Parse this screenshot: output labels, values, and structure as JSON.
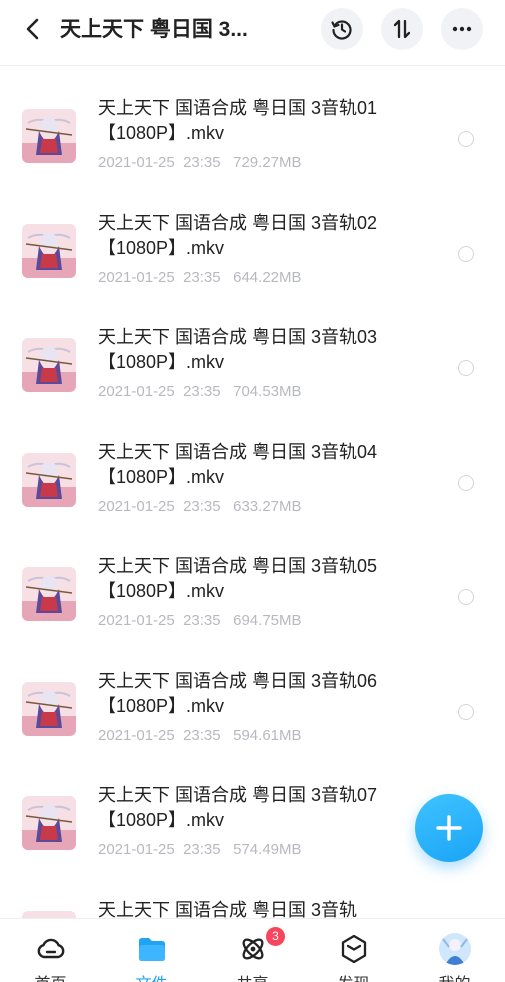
{
  "header": {
    "title": "天上天下 粤日国 3...",
    "back_icon": "chevron-left-icon",
    "history_icon": "history-icon",
    "sort_icon": "sort-icon",
    "more_icon": "more-icon"
  },
  "files": [
    {
      "name": "天上天下 国语合成 粤日国 3音轨01【1080P】.mkv",
      "date": "2021-01-25  23:35",
      "size": "729.27MB"
    },
    {
      "name": "天上天下 国语合成 粤日国 3音轨02【1080P】.mkv",
      "date": "2021-01-25  23:35",
      "size": "644.22MB"
    },
    {
      "name": "天上天下 国语合成 粤日国 3音轨03【1080P】.mkv",
      "date": "2021-01-25  23:35",
      "size": "704.53MB"
    },
    {
      "name": "天上天下 国语合成 粤日国 3音轨04【1080P】.mkv",
      "date": "2021-01-25  23:35",
      "size": "633.27MB"
    },
    {
      "name": "天上天下 国语合成 粤日国 3音轨05【1080P】.mkv",
      "date": "2021-01-25  23:35",
      "size": "694.75MB"
    },
    {
      "name": "天上天下 国语合成 粤日国 3音轨06【1080P】.mkv",
      "date": "2021-01-25  23:35",
      "size": "594.61MB"
    },
    {
      "name": "天上天下 国语合成 粤日国 3音轨07【1080P】.mkv",
      "date": "2021-01-25  23:35",
      "size": "574.49MB"
    },
    {
      "name": "天上天下 国语合成 粤日国 3音轨",
      "date": "",
      "size": ""
    }
  ],
  "fab": {
    "icon": "plus-icon"
  },
  "tabs": [
    {
      "label": "首页",
      "icon": "cloud-icon"
    },
    {
      "label": "文件",
      "icon": "folder-icon"
    },
    {
      "label": "共享",
      "icon": "share-orbit-icon",
      "badge": "3"
    },
    {
      "label": "发现",
      "icon": "discover-cube-icon"
    },
    {
      "label": "我的",
      "icon": "avatar-icon"
    }
  ],
  "colors": {
    "accent": "#21a3f3",
    "badge": "#f6455c",
    "meta_text": "#b7b9bf"
  }
}
